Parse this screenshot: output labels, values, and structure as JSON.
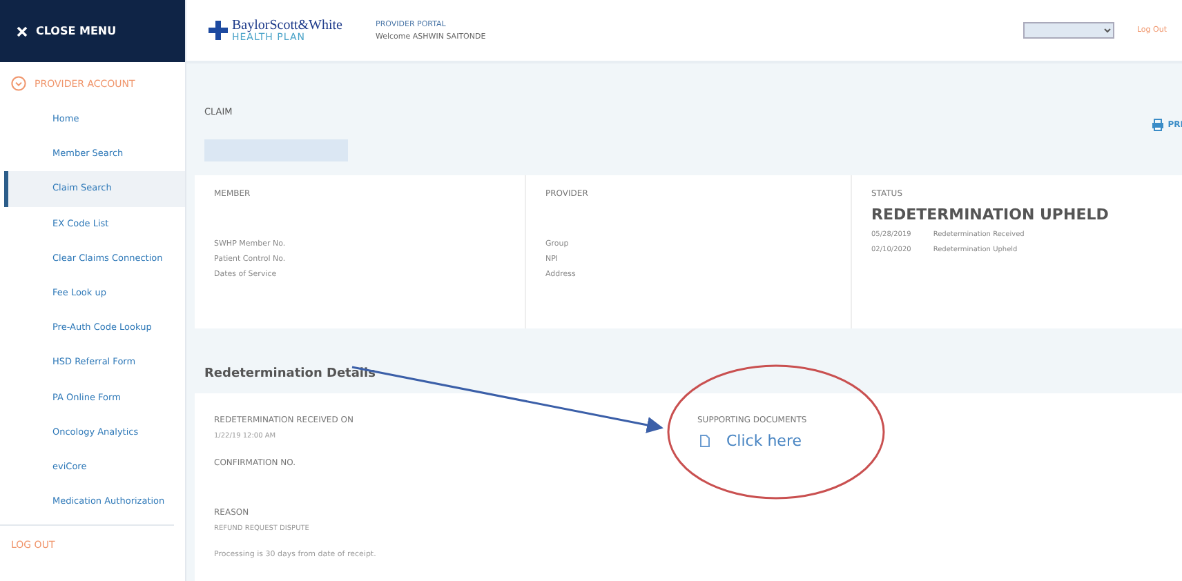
{
  "sidebar": {
    "close_label": "CLOSE MENU",
    "section": "PROVIDER ACCOUNT",
    "items": [
      {
        "label": "Home",
        "selected": false
      },
      {
        "label": "Member Search",
        "selected": false
      },
      {
        "label": "Claim Search",
        "selected": true
      },
      {
        "label": "EX Code List",
        "selected": false
      },
      {
        "label": "Clear Claims Connection",
        "selected": false
      },
      {
        "label": "Fee Look up",
        "selected": false
      },
      {
        "label": "Pre-Auth Code Lookup",
        "selected": false
      },
      {
        "label": "HSD Referral Form",
        "selected": false
      },
      {
        "label": "PA Online Form",
        "selected": false
      },
      {
        "label": "Oncology Analytics",
        "selected": false
      },
      {
        "label": "eviCore",
        "selected": false
      },
      {
        "label": "Medication Authorization",
        "selected": false
      }
    ],
    "logout": "LOG OUT"
  },
  "header": {
    "logo_name": "BaylorScott&White",
    "logo_sub": "HEALTH PLAN",
    "portal": "PROVIDER PORTAL",
    "welcome": "Welcome ASHWIN SAITONDE",
    "logout": "Log Out"
  },
  "claim": {
    "label": "CLAIM",
    "print": "PRI",
    "member": {
      "title": "MEMBER",
      "fields": [
        "SWHP Member No.",
        "Patient Control No.",
        "Dates of Service"
      ]
    },
    "provider": {
      "title": "PROVIDER",
      "fields": [
        "Group",
        "NPI",
        "Address"
      ]
    },
    "status": {
      "title": "STATUS",
      "value": "REDETERMINATION UPHELD",
      "history": [
        {
          "date": "05/28/2019",
          "event": "Redetermination Received"
        },
        {
          "date": "02/10/2020",
          "event": "Redetermination Upheld"
        }
      ]
    }
  },
  "details": {
    "title": "Redetermination Details",
    "received_label": "REDETERMINATION RECEIVED ON",
    "received_value": "1/22/19 12:00 AM",
    "confirmation_label": "CONFIRMATION NO.",
    "reason_label": "REASON",
    "reason_value": "REFUND REQUEST DISPUTE",
    "note": "Processing is 30 days from date of receipt.",
    "documents_label": "SUPPORTING DOCUMENTS",
    "documents_link": "Click here"
  }
}
